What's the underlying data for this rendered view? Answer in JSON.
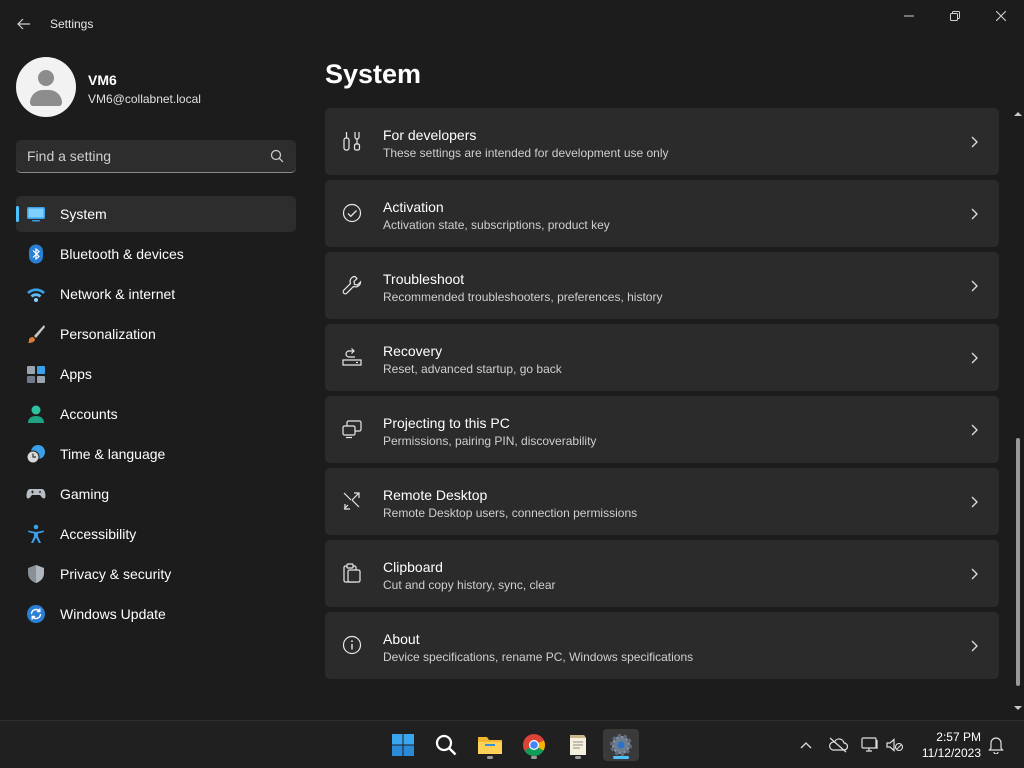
{
  "window": {
    "title": "Settings"
  },
  "profile": {
    "name": "VM6",
    "email": "VM6@collabnet.local"
  },
  "search": {
    "placeholder": "Find a setting"
  },
  "nav": {
    "items": [
      {
        "label": "System",
        "icon": "system-icon",
        "selected": true
      },
      {
        "label": "Bluetooth & devices",
        "icon": "bluetooth-icon"
      },
      {
        "label": "Network & internet",
        "icon": "wifi-icon"
      },
      {
        "label": "Personalization",
        "icon": "brush-icon"
      },
      {
        "label": "Apps",
        "icon": "apps-icon"
      },
      {
        "label": "Accounts",
        "icon": "person-icon"
      },
      {
        "label": "Time & language",
        "icon": "clock-globe-icon"
      },
      {
        "label": "Gaming",
        "icon": "gamepad-icon"
      },
      {
        "label": "Accessibility",
        "icon": "accessibility-icon"
      },
      {
        "label": "Privacy & security",
        "icon": "shield-icon"
      },
      {
        "label": "Windows Update",
        "icon": "update-icon"
      }
    ]
  },
  "main": {
    "title": "System",
    "cards": [
      {
        "title": "For developers",
        "subtitle": "These settings are intended for development use only",
        "icon": "developer-tools-icon"
      },
      {
        "title": "Activation",
        "subtitle": "Activation state, subscriptions, product key",
        "icon": "check-circle-icon"
      },
      {
        "title": "Troubleshoot",
        "subtitle": "Recommended troubleshooters, preferences, history",
        "icon": "wrench-icon"
      },
      {
        "title": "Recovery",
        "subtitle": "Reset, advanced startup, go back",
        "icon": "recovery-icon"
      },
      {
        "title": "Projecting to this PC",
        "subtitle": "Permissions, pairing PIN, discoverability",
        "icon": "projector-icon"
      },
      {
        "title": "Remote Desktop",
        "subtitle": "Remote Desktop users, connection permissions",
        "icon": "remote-desktop-icon"
      },
      {
        "title": "Clipboard",
        "subtitle": "Cut and copy history, sync, clear",
        "icon": "clipboard-icon"
      },
      {
        "title": "About",
        "subtitle": "Device specifications, rename PC, Windows specifications",
        "icon": "info-icon"
      }
    ]
  },
  "taskbar": {
    "apps": [
      "windows-start-icon",
      "search-icon",
      "file-explorer-icon",
      "chrome-icon",
      "notepad-icon",
      "settings-gear-icon"
    ],
    "clock": {
      "time": "2:57 PM",
      "date": "11/12/2023"
    }
  },
  "colors": {
    "background": "#1c1c1c",
    "card": "#2b2b2b",
    "accent": "#4cc2ff",
    "taskbar": "#202020"
  }
}
